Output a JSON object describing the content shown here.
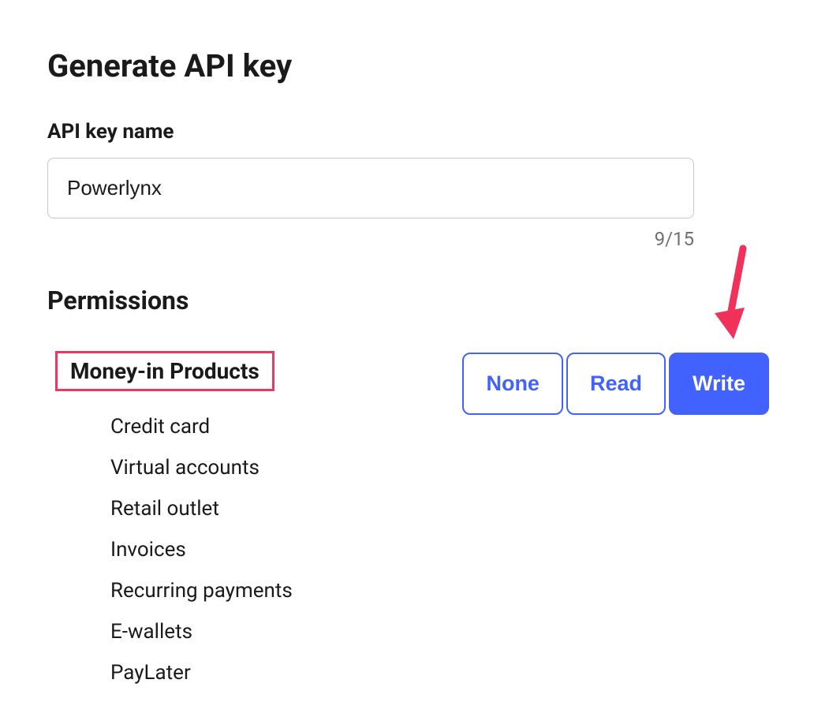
{
  "page_title": "Generate API key",
  "api_key_name": {
    "label": "API key name",
    "value": "Powerlynx",
    "char_counter": "9/15"
  },
  "permissions": {
    "section_title": "Permissions",
    "group_name": "Money-in Products",
    "items": [
      "Credit card",
      "Virtual accounts",
      "Retail outlet",
      "Invoices",
      "Recurring payments",
      "E-wallets",
      "PayLater"
    ],
    "toggle": {
      "none_label": "None",
      "read_label": "Read",
      "write_label": "Write",
      "selected": "Write"
    }
  },
  "colors": {
    "primary": "#4162ff",
    "highlight_border": "#e63963",
    "arrow": "#f0325a"
  }
}
